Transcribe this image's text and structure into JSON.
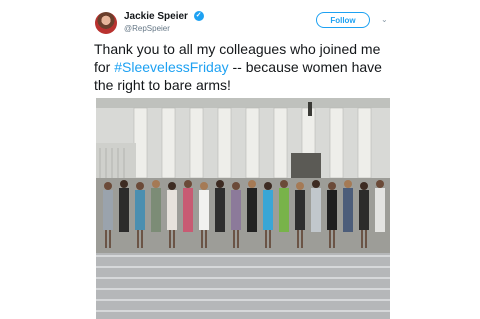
{
  "tweet": {
    "author_name": "Jackie Speier",
    "handle": "@RepSpeier",
    "follow_label": "Follow",
    "text_before": "Thank you to all my colleagues who joined me for ",
    "hashtag": "#SleevelessFriday",
    "text_after": " -- because women have the right to bare arms!"
  },
  "icons": {
    "verified": "verified-badge-icon",
    "chevron": "chevron-down-icon"
  },
  "colors": {
    "accent": "#1da1f2",
    "text": "#14171a",
    "muted": "#657786"
  }
}
